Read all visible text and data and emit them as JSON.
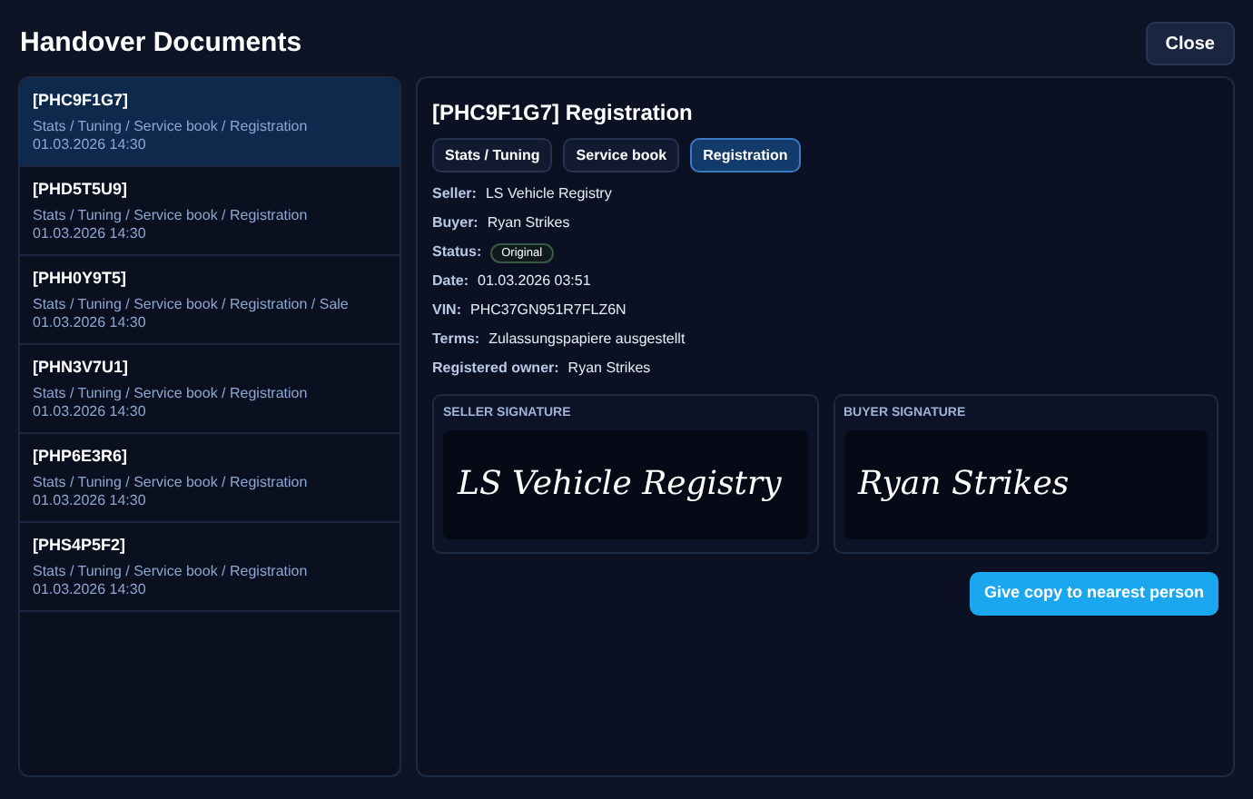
{
  "window": {
    "title": "Handover Documents",
    "close": "Close"
  },
  "documents": [
    {
      "id": "[PHC9F1G7]",
      "sections": "Stats / Tuning / Service book / Registration",
      "date": "01.03.2026 14:30",
      "selected": true
    },
    {
      "id": "[PHD5T5U9]",
      "sections": "Stats / Tuning / Service book / Registration",
      "date": "01.03.2026 14:30",
      "selected": false
    },
    {
      "id": "[PHH0Y9T5]",
      "sections": "Stats / Tuning / Service book / Registration / Sale",
      "date": "01.03.2026 14:30",
      "selected": false
    },
    {
      "id": "[PHN3V7U1]",
      "sections": "Stats / Tuning / Service book / Registration",
      "date": "01.03.2026 14:30",
      "selected": false
    },
    {
      "id": "[PHP6E3R6]",
      "sections": "Stats / Tuning / Service book / Registration",
      "date": "01.03.2026 14:30",
      "selected": false
    },
    {
      "id": "[PHS4P5F2]",
      "sections": "Stats / Tuning / Service book / Registration",
      "date": "01.03.2026 14:30",
      "selected": false
    }
  ],
  "detail": {
    "title": "[PHC9F1G7] Registration",
    "tabs": [
      {
        "label": "Stats / Tuning",
        "selected": false
      },
      {
        "label": "Service book",
        "selected": false
      },
      {
        "label": "Registration",
        "selected": true
      }
    ],
    "fields": [
      {
        "label": "Seller:",
        "value": "LS Vehicle Registry",
        "kind": "text"
      },
      {
        "label": "Buyer:",
        "value": "Ryan Strikes",
        "kind": "text"
      },
      {
        "label": "Status:",
        "value": "Original",
        "kind": "badge"
      },
      {
        "label": "Date:",
        "value": "01.03.2026 03:51",
        "kind": "text"
      },
      {
        "label": "VIN:",
        "value": "PHC37GN951R7FLZ6N",
        "kind": "text"
      },
      {
        "label": "Terms:",
        "value": "Zulassungspapiere ausgestellt",
        "kind": "text"
      },
      {
        "label": "Registered owner:",
        "value": "Ryan Strikes",
        "kind": "text"
      }
    ],
    "signatures": [
      {
        "label": "SELLER SIGNATURE",
        "signature": "LS Vehicle Registry"
      },
      {
        "label": "BUYER SIGNATURE",
        "signature": "Ryan Strikes"
      }
    ],
    "action": "Give copy to nearest person"
  }
}
